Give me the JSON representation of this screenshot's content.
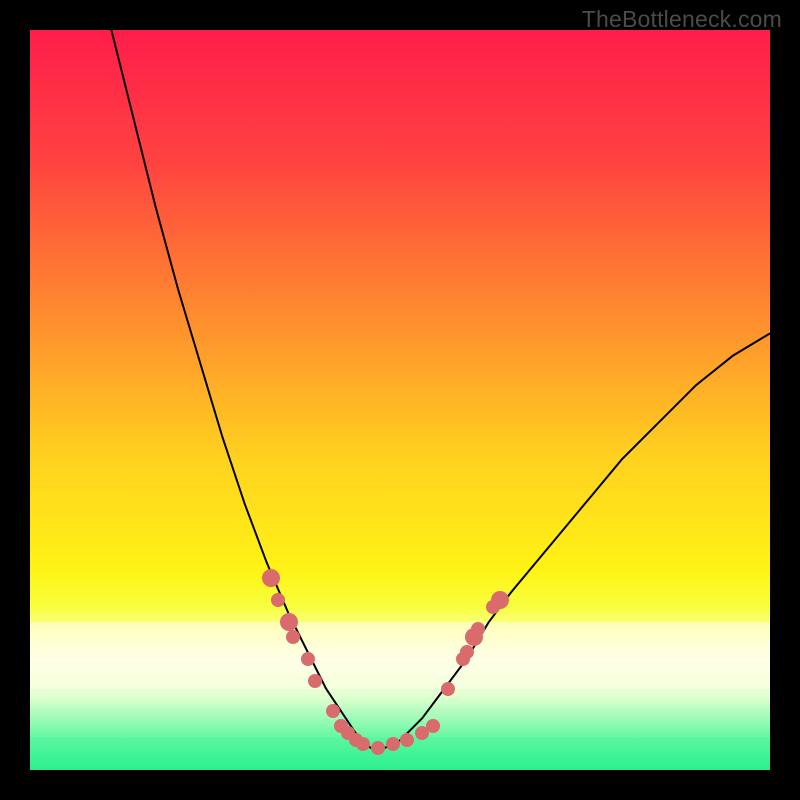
{
  "watermark": "TheBottleneck.com",
  "colors": {
    "frame_bg": "#000000",
    "curve": "#000000",
    "dot": "#d96b6d",
    "gradient_stops": [
      {
        "pct": 0,
        "color": "#ff1d4b"
      },
      {
        "pct": 18,
        "color": "#ff4340"
      },
      {
        "pct": 38,
        "color": "#ff8a2f"
      },
      {
        "pct": 58,
        "color": "#ffd21f"
      },
      {
        "pct": 73,
        "color": "#fff315"
      },
      {
        "pct": 78,
        "color": "#f7ff3e"
      },
      {
        "pct": 82,
        "color": "#ffffb0"
      },
      {
        "pct": 85,
        "color": "#ffffe6"
      },
      {
        "pct": 90,
        "color": "#e2ffd0"
      },
      {
        "pct": 96,
        "color": "#5cf7a0"
      },
      {
        "pct": 100,
        "color": "#2af08e"
      }
    ],
    "pale_band": "#ffffe6",
    "green_band_top": "#5cf7a0",
    "green_band_bottom": "#2af08e"
  },
  "layout": {
    "pale_band": {
      "top_pct": 80,
      "height_pct": 9
    },
    "green_band": {
      "top_pct": 95.5,
      "height_pct": 4.5
    }
  },
  "chart_data": {
    "type": "line",
    "title": "",
    "xlabel": "",
    "ylabel": "",
    "xlim": [
      0,
      100
    ],
    "ylim": [
      0,
      100
    ],
    "note": "Axes unlabeled in image; values are normalized 0–100 to the plot area. y increases downward as rendered (top=0). Curve is a V-shaped bottleneck profile with minimum near x≈47.",
    "series": [
      {
        "name": "bottleneck-curve",
        "x": [
          11,
          14,
          17,
          20,
          23,
          26,
          29,
          32,
          35,
          38,
          40,
          42,
          44,
          46,
          48,
          50,
          53,
          56,
          59,
          62,
          65,
          70,
          75,
          80,
          85,
          90,
          95,
          100
        ],
        "y": [
          0,
          12,
          24,
          35,
          45,
          55,
          64,
          72,
          79,
          85,
          89,
          92,
          95,
          97,
          97,
          96,
          93,
          89,
          85,
          80,
          76,
          70,
          64,
          58,
          53,
          48,
          44,
          41
        ]
      }
    ],
    "markers": {
      "name": "highlighted-points",
      "comment": "Salmon dots clustered on the curve near the valley and along the green band.",
      "points": [
        {
          "x": 32.5,
          "y": 74,
          "size": "big"
        },
        {
          "x": 33.5,
          "y": 77,
          "size": "normal"
        },
        {
          "x": 35.0,
          "y": 80,
          "size": "big"
        },
        {
          "x": 35.5,
          "y": 82,
          "size": "normal"
        },
        {
          "x": 37.5,
          "y": 85,
          "size": "normal"
        },
        {
          "x": 38.5,
          "y": 88,
          "size": "normal"
        },
        {
          "x": 41.0,
          "y": 92,
          "size": "normal"
        },
        {
          "x": 42.0,
          "y": 94,
          "size": "normal"
        },
        {
          "x": 43.0,
          "y": 95,
          "size": "normal"
        },
        {
          "x": 44.0,
          "y": 96,
          "size": "normal"
        },
        {
          "x": 45.0,
          "y": 96.5,
          "size": "normal"
        },
        {
          "x": 47.0,
          "y": 97,
          "size": "normal"
        },
        {
          "x": 49.0,
          "y": 96.5,
          "size": "normal"
        },
        {
          "x": 51.0,
          "y": 96,
          "size": "normal"
        },
        {
          "x": 53.0,
          "y": 95,
          "size": "normal"
        },
        {
          "x": 54.5,
          "y": 94,
          "size": "normal"
        },
        {
          "x": 56.5,
          "y": 89,
          "size": "normal"
        },
        {
          "x": 58.5,
          "y": 85,
          "size": "normal"
        },
        {
          "x": 59.0,
          "y": 84,
          "size": "normal"
        },
        {
          "x": 60.0,
          "y": 82,
          "size": "big"
        },
        {
          "x": 60.5,
          "y": 81,
          "size": "normal"
        },
        {
          "x": 62.5,
          "y": 78,
          "size": "normal"
        },
        {
          "x": 63.5,
          "y": 77,
          "size": "big"
        }
      ]
    }
  }
}
